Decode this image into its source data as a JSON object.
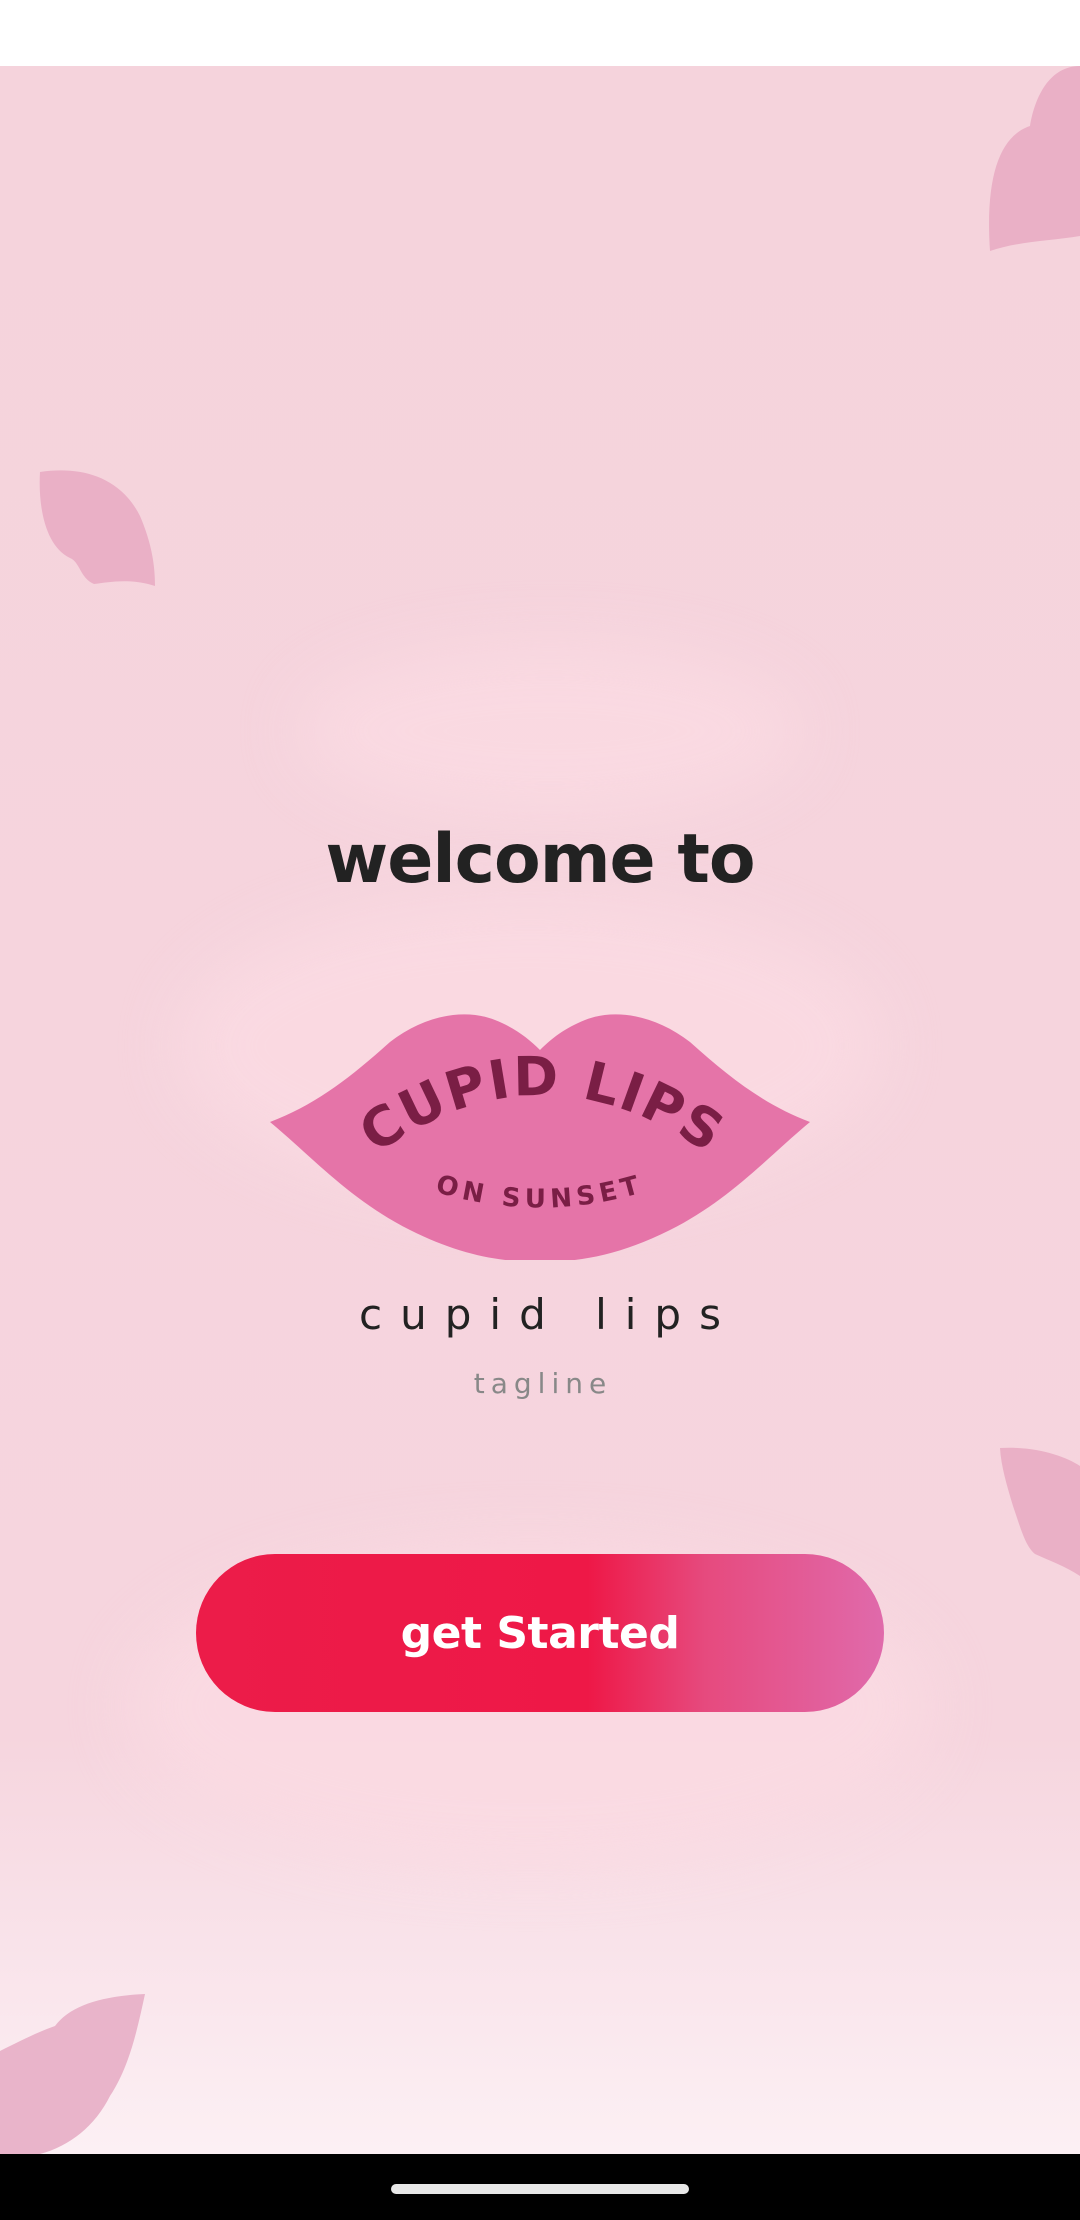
{
  "welcome": {
    "title": "welcome to"
  },
  "logo": {
    "arc_text": "CUPID LIPS",
    "sub_text": "ON SUNSET"
  },
  "brand": {
    "name": "cupid lips",
    "tagline": "tagline"
  },
  "cta": {
    "label": "get Started"
  },
  "colors": {
    "background": "#f5d3dc",
    "petal": "#eab0c6",
    "lips": "#e574a8",
    "logo_text": "#7a1e45",
    "button_start": "#ec1c49",
    "button_end": "#e06aab",
    "title_text": "#222222",
    "tagline_text": "#888888"
  },
  "icons": {
    "petals": [
      "lip-petal-icon",
      "lip-petal-icon",
      "lip-petal-icon",
      "lip-petal-icon"
    ],
    "logo": "lips-logo"
  }
}
